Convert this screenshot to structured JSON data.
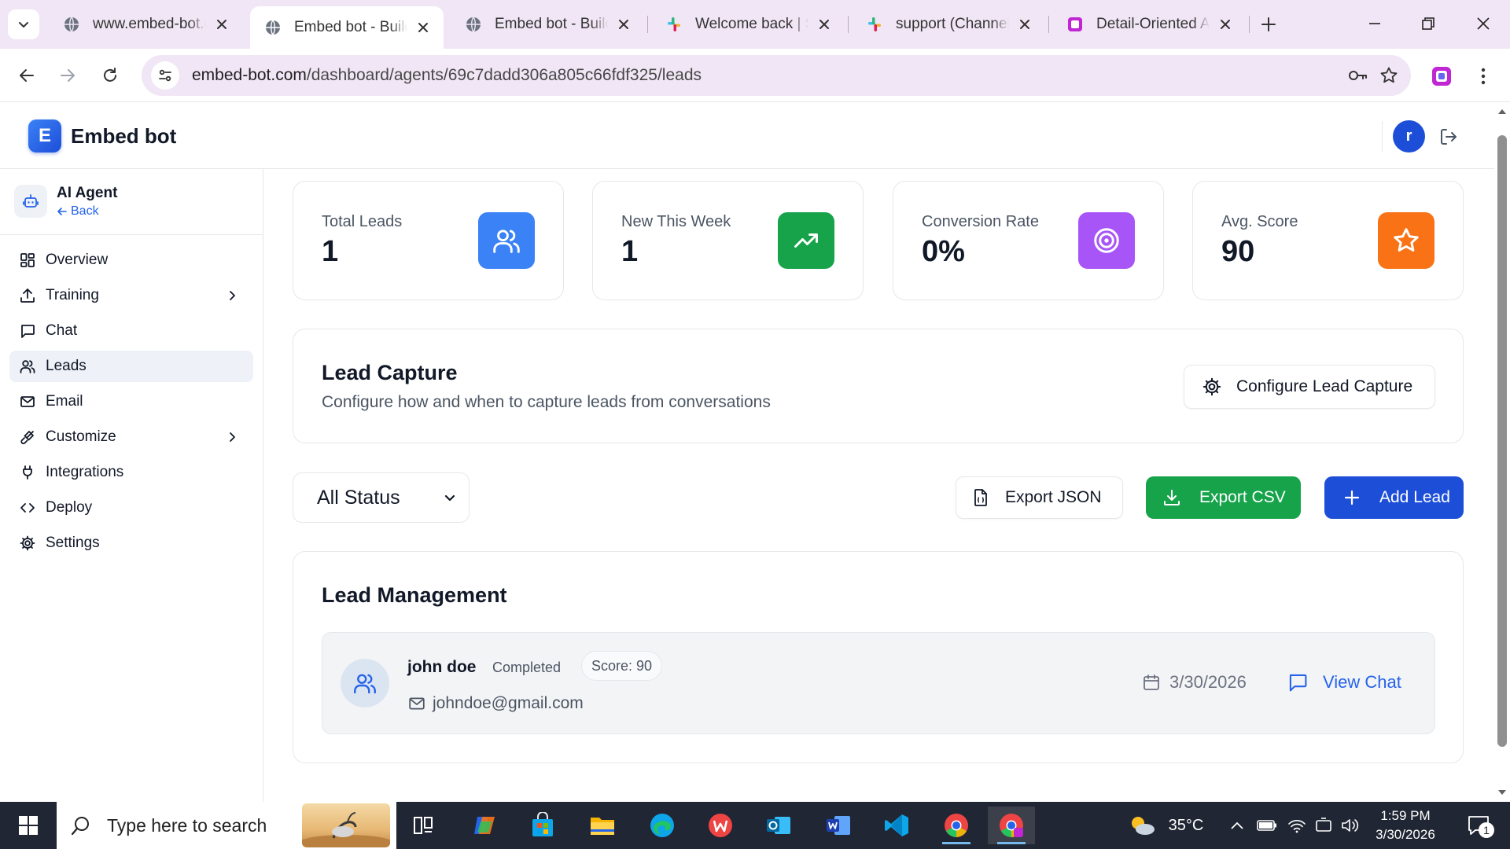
{
  "browser": {
    "tabs": [
      {
        "title": "www.embed-bot.com",
        "favicon": "globe-icon",
        "active": false
      },
      {
        "title": "Embed bot - Build",
        "favicon": "globe-icon",
        "active": true
      },
      {
        "title": "Embed bot - Build",
        "favicon": "globe-icon",
        "active": false
      },
      {
        "title": "Welcome back | Slack",
        "favicon": "slack-icon",
        "active": false
      },
      {
        "title": "support (Channel)",
        "favicon": "slack-icon",
        "active": false
      },
      {
        "title": "Detail-Oriented AI",
        "favicon": "app-icon",
        "active": false
      }
    ],
    "url_host": "embed-bot.com",
    "url_path": "/dashboard/agents/69c7dadd306a805c66fdf325/leads"
  },
  "app": {
    "logo_letter": "E",
    "brand": "Embed bot",
    "user_initial": "r"
  },
  "sidebar": {
    "agent_name": "AI Agent",
    "back_label": "Back",
    "items": [
      {
        "label": "Overview",
        "icon": "grid-icon",
        "chevron": false,
        "active": false
      },
      {
        "label": "Training",
        "icon": "upload-icon",
        "chevron": true,
        "active": false
      },
      {
        "label": "Chat",
        "icon": "chat-icon",
        "chevron": false,
        "active": false
      },
      {
        "label": "Leads",
        "icon": "users-icon",
        "chevron": false,
        "active": true
      },
      {
        "label": "Email",
        "icon": "mail-icon",
        "chevron": false,
        "active": false
      },
      {
        "label": "Customize",
        "icon": "brush-icon",
        "chevron": true,
        "active": false
      },
      {
        "label": "Integrations",
        "icon": "plug-icon",
        "chevron": false,
        "active": false
      },
      {
        "label": "Deploy",
        "icon": "code-icon",
        "chevron": false,
        "active": false
      },
      {
        "label": "Settings",
        "icon": "gear-icon",
        "chevron": false,
        "active": false
      }
    ]
  },
  "stats": [
    {
      "label": "Total Leads",
      "value": "1",
      "icon": "users-icon",
      "color": "#3b82f6"
    },
    {
      "label": "New This Week",
      "value": "1",
      "icon": "trending-up-icon",
      "color": "#16a34a"
    },
    {
      "label": "Conversion Rate",
      "value": "0%",
      "icon": "target-icon",
      "color": "#a855f7"
    },
    {
      "label": "Avg. Score",
      "value": "90",
      "icon": "star-icon",
      "color": "#f97316"
    }
  ],
  "lead_capture": {
    "title": "Lead Capture",
    "subtitle": "Configure how and when to capture leads from conversations",
    "configure_label": "Configure Lead Capture"
  },
  "filters": {
    "status_selected": "All Status",
    "export_json_label": "Export JSON",
    "export_csv_label": "Export CSV",
    "add_lead_label": "Add Lead"
  },
  "colors": {
    "primary": "#2563eb",
    "export_csv": "#16a34a",
    "add_lead": "#1d4ed8"
  },
  "lead_management": {
    "title": "Lead Management",
    "leads": [
      {
        "name": "john doe",
        "status": "Completed",
        "score": "Score: 90",
        "email": "johndoe@gmail.com",
        "date": "3/30/2026",
        "action": "View Chat"
      }
    ]
  },
  "taskbar": {
    "search_placeholder": "Type here to search",
    "weather": "35°C",
    "time": "1:59 PM",
    "date": "3/30/2026",
    "notification_count": "1"
  }
}
